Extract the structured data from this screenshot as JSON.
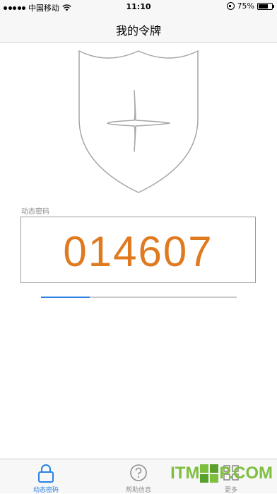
{
  "status_bar": {
    "carrier": "中国移动",
    "time": "11:10",
    "battery_text": "75%",
    "battery_level": 0.75
  },
  "nav": {
    "title": "我的令牌"
  },
  "otp": {
    "label": "动态密码",
    "code": "014607",
    "progress": 0.25,
    "code_color": "#e07a20",
    "progress_color": "#2a82e4"
  },
  "tabs": [
    {
      "label": "动态密码",
      "icon": "lock-icon",
      "active": true
    },
    {
      "label": "帮助信息",
      "icon": "question-icon",
      "active": false
    },
    {
      "label": "更多",
      "icon": "more-grid-icon",
      "active": false
    }
  ],
  "watermark": {
    "left": "ITM",
    "right": "P.COM",
    "color": "#7fbf3f"
  }
}
